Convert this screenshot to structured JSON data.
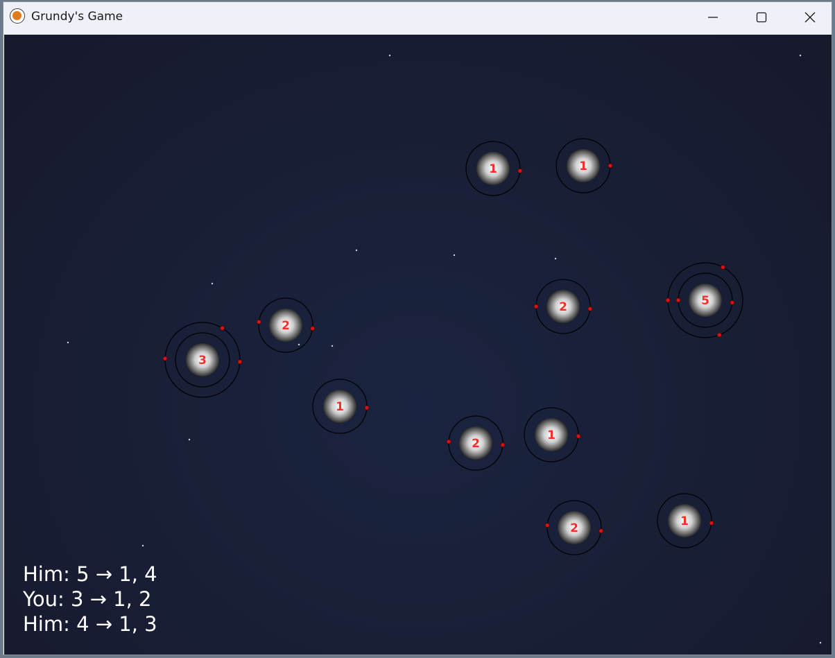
{
  "window": {
    "title": "Grundy's Game",
    "buttons": {
      "minimize_icon": "minimize-icon",
      "maximize_icon": "maximize-icon",
      "close_icon": "close-icon"
    }
  },
  "colors": {
    "background": "#17192c",
    "ring": "#000000",
    "moon": "#e01010",
    "label": "#ff2a2a",
    "text": "#ffffff"
  },
  "piles": [
    {
      "label": "1",
      "moons": 1
    },
    {
      "label": "1",
      "moons": 1
    },
    {
      "label": "2",
      "moons": 2
    },
    {
      "label": "5",
      "moons": 5
    },
    {
      "label": "2",
      "moons": 2
    },
    {
      "label": "3",
      "moons": 3
    },
    {
      "label": "1",
      "moons": 1
    },
    {
      "label": "2",
      "moons": 2
    },
    {
      "label": "1",
      "moons": 1
    },
    {
      "label": "2",
      "moons": 2
    },
    {
      "label": "1",
      "moons": 1
    }
  ],
  "move_log": [
    "Him: 5 → 1, 4",
    "You: 3 → 1, 2",
    "Him: 4 → 1, 3"
  ]
}
